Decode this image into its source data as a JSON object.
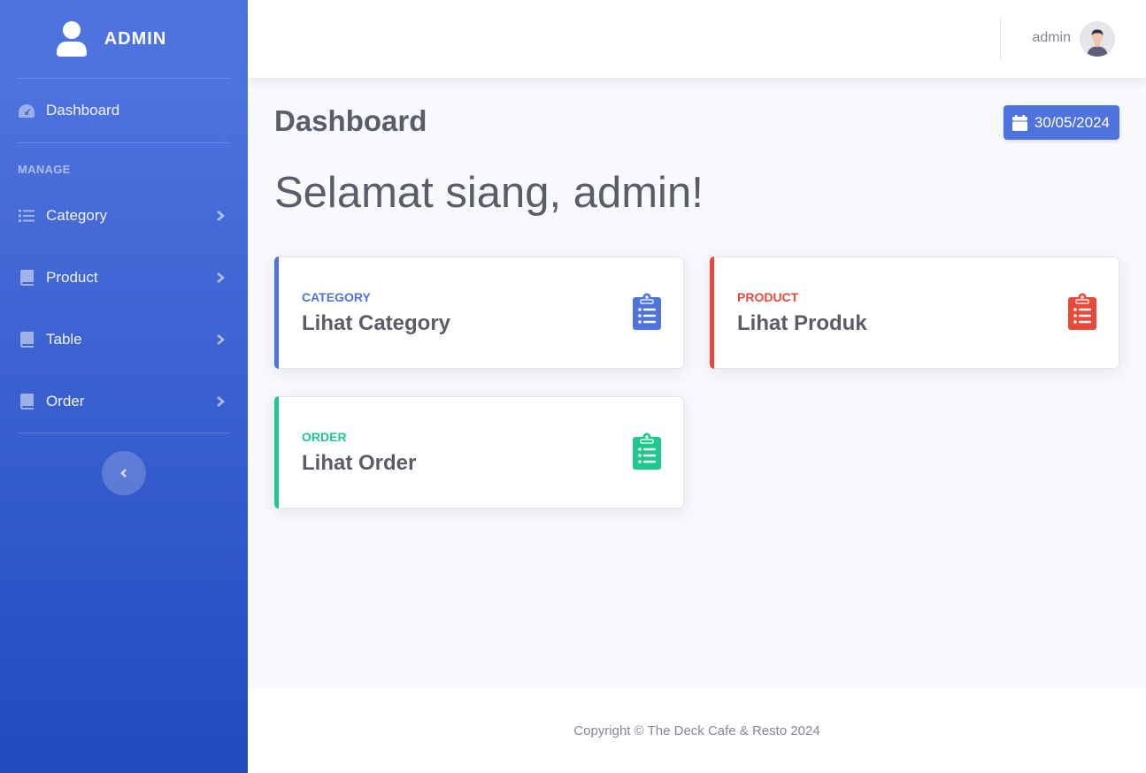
{
  "sidebar": {
    "brand": "ADMIN",
    "dashboard_label": "Dashboard",
    "heading": "MANAGE",
    "items": [
      {
        "label": "Category",
        "icon": "list-icon"
      },
      {
        "label": "Product",
        "icon": "book-icon"
      },
      {
        "label": "Table",
        "icon": "book-icon"
      },
      {
        "label": "Order",
        "icon": "book-icon"
      }
    ]
  },
  "topbar": {
    "user_name": "admin"
  },
  "main": {
    "page_title": "Dashboard",
    "date": "30/05/2024",
    "greeting": "Selamat siang, admin!",
    "cards": [
      {
        "kicker": "CATEGORY",
        "title": "Lihat Category",
        "color": "#4e73df"
      },
      {
        "kicker": "PRODUCT",
        "title": "Lihat Produk",
        "color": "#e74a3b"
      },
      {
        "kicker": "ORDER",
        "title": "Lihat Order",
        "color": "#1cc88a"
      }
    ]
  },
  "footer": {
    "copyright": "Copyright © The Deck Cafe & Resto 2024"
  },
  "colors": {
    "primary": "#4e73df",
    "danger": "#e74a3b",
    "success": "#1cc88a",
    "text": "#5a5c69",
    "muted": "#858796"
  }
}
